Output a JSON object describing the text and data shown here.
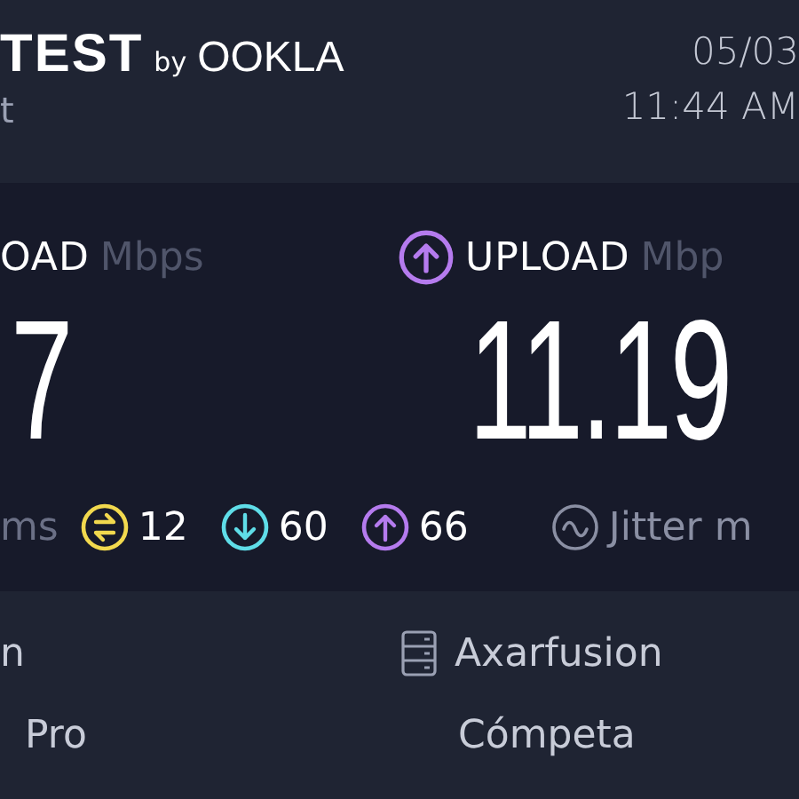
{
  "header": {
    "logo": "TEST",
    "logo_by": "by",
    "logo_brand": "OOKLA",
    "subtitle": "t",
    "date": "05/03",
    "time": "11:44 AM"
  },
  "results": [
    {
      "kind": "download",
      "label": "OAD",
      "unit": "Mbps",
      "value": "7"
    },
    {
      "kind": "upload",
      "label": "UPLOAD",
      "unit": "Mbp",
      "value": "11.19"
    }
  ],
  "ping": {
    "unit": "ms",
    "stats": [
      {
        "kind": "idle",
        "value": "12"
      },
      {
        "kind": "download",
        "value": "60"
      },
      {
        "kind": "upload",
        "value": "66"
      }
    ],
    "jitter_label": "Jitter m"
  },
  "info": [
    {
      "kind": "provider",
      "name": "n",
      "detail": "Pro"
    },
    {
      "kind": "server",
      "name": "Axarfusion",
      "detail": "Cómpeta"
    }
  ]
}
